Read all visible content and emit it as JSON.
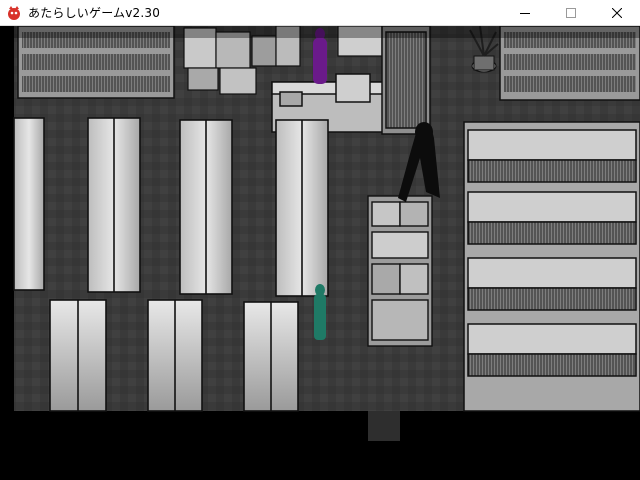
{
  "window": {
    "title": "あたらしいゲームv2.30",
    "icon": "game-app-icon",
    "controls": [
      "minimize-icon",
      "maximize-icon",
      "close-icon"
    ]
  },
  "scene": {
    "description_free": true,
    "characters": [
      {
        "name": "purple-figure",
        "color": "#6a1a8a"
      },
      {
        "name": "shadow-creature",
        "color": "#0c0c0c"
      },
      {
        "name": "player-character",
        "color": "#1f7a66"
      }
    ],
    "palette": {
      "floor": "#3b3b3b",
      "wall": "#000000",
      "furniture_light": "#cfcfcf",
      "furniture_dark": "#8a8a8a"
    }
  }
}
